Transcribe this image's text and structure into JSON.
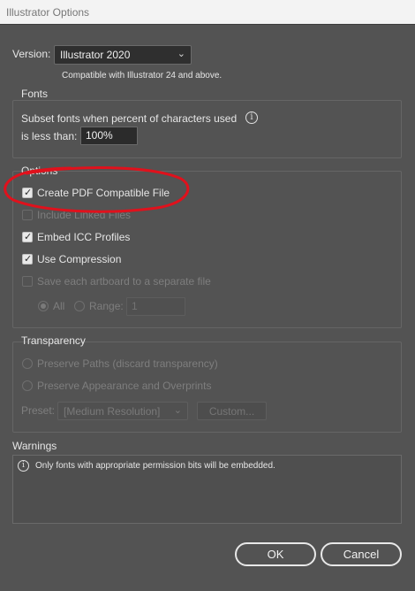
{
  "window": {
    "title": "Illustrator Options"
  },
  "version": {
    "label": "Version:",
    "selected": "Illustrator 2020",
    "note": "Compatible with Illustrator 24 and above."
  },
  "fonts": {
    "title": "Fonts",
    "subset_line1": "Subset fonts when percent of characters used",
    "subset_line2": "is less than:",
    "percent": "100%"
  },
  "options": {
    "title": "Options",
    "create_pdf": "Create PDF Compatible File",
    "include_linked": "Include Linked Files",
    "embed_icc": "Embed ICC Profiles",
    "use_compression": "Use Compression",
    "save_artboard": "Save each artboard to a separate file",
    "all_label": "All",
    "range_label": "Range:",
    "range_value": "1"
  },
  "transparency": {
    "title": "Transparency",
    "preserve_paths": "Preserve Paths (discard transparency)",
    "preserve_appearance": "Preserve Appearance and Overprints",
    "preset_label": "Preset:",
    "preset_value": "[Medium Resolution]",
    "custom_label": "Custom..."
  },
  "warnings": {
    "title": "Warnings",
    "message": "Only fonts with appropriate permission bits will be embedded."
  },
  "buttons": {
    "ok": "OK",
    "cancel": "Cancel"
  },
  "colors": {
    "background": "#535353",
    "annotation": "#e0111c"
  }
}
